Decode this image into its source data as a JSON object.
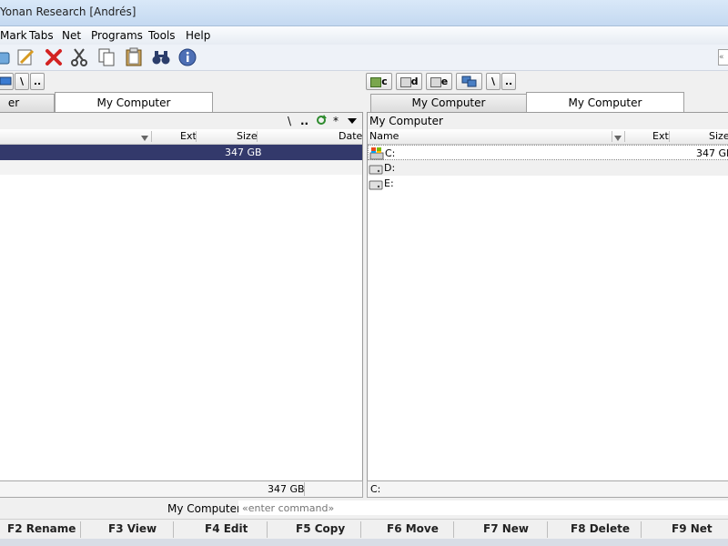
{
  "window": {
    "title": "Yonan Research [Andrés]"
  },
  "menu": [
    "Mark",
    "Tabs",
    "Net",
    "Programs",
    "Tools",
    "Help"
  ],
  "toolbar_icons": [
    "drive-icon",
    "edit-icon",
    "delete-icon",
    "cut-icon",
    "copy-icon",
    "paste-icon",
    "search-binoculars-icon",
    "info-icon"
  ],
  "left": {
    "drive_buttons": [
      "\\",
      ".."
    ],
    "tabs": [
      "er",
      "My Computer"
    ],
    "tools": [
      "\\",
      "..",
      "*"
    ],
    "columns": {
      "ext": "Ext",
      "size": "Size",
      "date": "Date"
    },
    "rows": [
      {
        "name": "",
        "size": "347 GB",
        "selected": true
      }
    ],
    "status": "347 GB"
  },
  "right": {
    "drive_buttons": [
      "c",
      "d",
      "e",
      "",
      "\\",
      ".."
    ],
    "tabs": [
      "My Computer",
      "My Computer"
    ],
    "path": "My Computer",
    "columns": {
      "name": "Name",
      "ext": "Ext",
      "size": "Size"
    },
    "rows": [
      {
        "name": "C:",
        "size": "347 GB"
      },
      {
        "name": "D:",
        "size": ""
      },
      {
        "name": "E:",
        "size": ""
      }
    ],
    "status": "C:"
  },
  "cmdline": {
    "label": "My Computer",
    "placeholder": "«enter command»",
    "right_box": "«"
  },
  "fkeys": [
    "F2 Rename",
    "F3 View",
    "F4 Edit",
    "F5 Copy",
    "F6 Move",
    "F7 New",
    "F8 Delete",
    "F9 Net"
  ],
  "colors": {
    "selection": "#33396b",
    "accent": "#1f6fd1"
  }
}
